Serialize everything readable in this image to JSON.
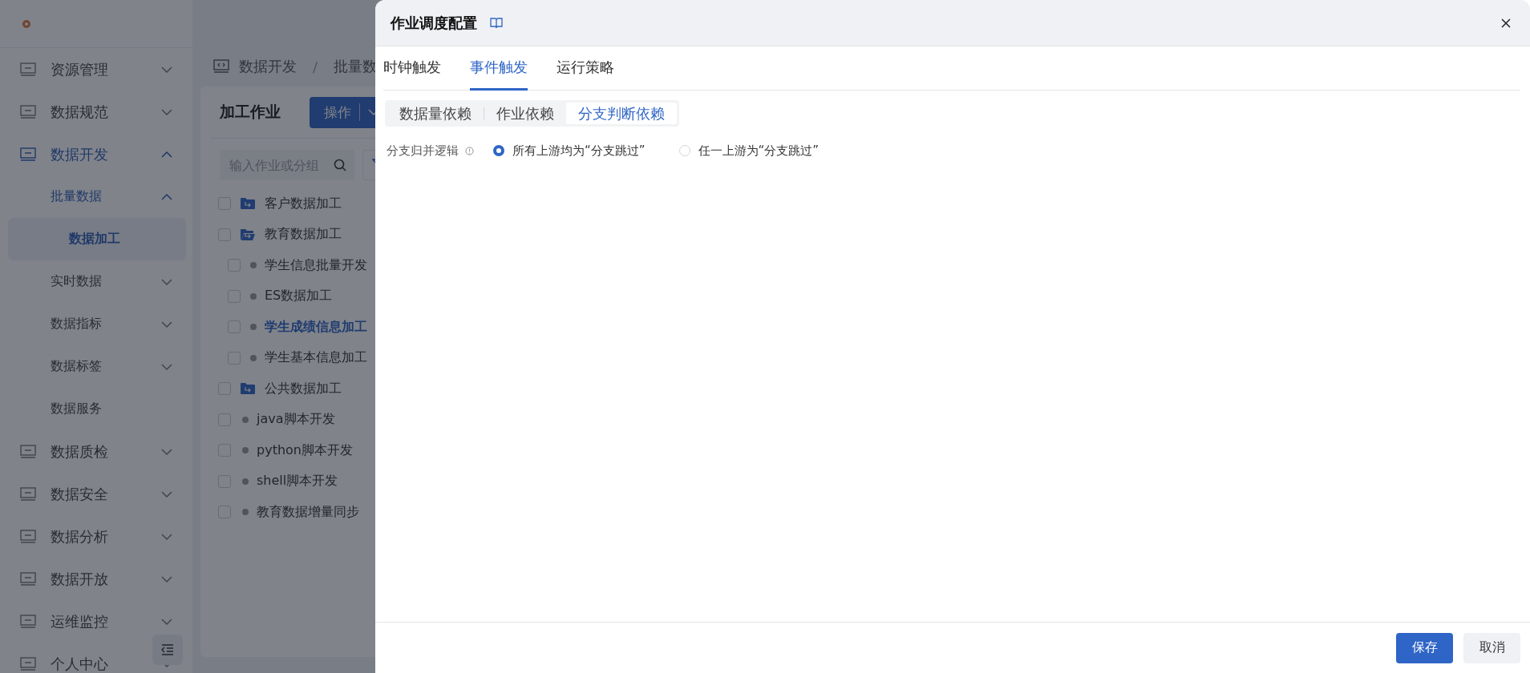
{
  "sidebar": {
    "items": [
      {
        "label": "资源管理",
        "expanded": false,
        "selected": false
      },
      {
        "label": "数据规范",
        "expanded": false,
        "selected": false
      },
      {
        "label": "数据开发",
        "expanded": true,
        "selected": false,
        "children": [
          {
            "label": "批量数据",
            "expanded": true,
            "selected": false,
            "children": [
              {
                "label": "数据加工",
                "selected": true
              }
            ]
          },
          {
            "label": "实时数据",
            "expanded": false,
            "selected": false
          },
          {
            "label": "数据指标",
            "expanded": false,
            "selected": false
          },
          {
            "label": "数据标签",
            "expanded": false,
            "selected": false
          },
          {
            "label": "数据服务",
            "selected": false
          }
        ]
      },
      {
        "label": "数据质检",
        "expanded": false,
        "selected": false
      },
      {
        "label": "数据安全",
        "expanded": false,
        "selected": false
      },
      {
        "label": "数据分析",
        "expanded": false,
        "selected": false
      },
      {
        "label": "数据开放",
        "expanded": false,
        "selected": false
      },
      {
        "label": "运维监控",
        "expanded": false,
        "selected": false
      },
      {
        "label": "个人中心",
        "expanded": false,
        "selected": false
      }
    ]
  },
  "breadcrumb": [
    "数据开发",
    "/",
    "批量数"
  ],
  "panel": {
    "title": "加工作业",
    "action_button": "操作",
    "search": {
      "placeholder": "输入作业或分组"
    }
  },
  "tree": [
    {
      "kind": "folder",
      "label": "客户数据加工",
      "expanded": false,
      "checked": false,
      "selected": false
    },
    {
      "kind": "folder",
      "label": "教育数据加工",
      "expanded": true,
      "checked": false,
      "selected": false,
      "children": [
        {
          "kind": "job",
          "label": "学生信息批量开发",
          "checked": false,
          "selected": false
        },
        {
          "kind": "job",
          "label": "ES数据加工",
          "checked": false,
          "selected": false
        },
        {
          "kind": "job",
          "label": "学生成绩信息加工",
          "checked": false,
          "selected": true
        },
        {
          "kind": "job",
          "label": "学生基本信息加工",
          "checked": false,
          "selected": false
        }
      ]
    },
    {
      "kind": "folder",
      "label": "公共数据加工",
      "expanded": false,
      "checked": false,
      "selected": false
    },
    {
      "kind": "job",
      "label": "java脚本开发",
      "checked": false,
      "selected": false
    },
    {
      "kind": "job",
      "label": "python脚本开发",
      "checked": false,
      "selected": false
    },
    {
      "kind": "job",
      "label": "shell脚本开发",
      "checked": false,
      "selected": false
    },
    {
      "kind": "job",
      "label": "教育数据增量同步",
      "checked": false,
      "selected": false
    }
  ],
  "drawer": {
    "title": "作业调度配置",
    "tabs": [
      {
        "label": "时钟触发",
        "selected": false
      },
      {
        "label": "事件触发",
        "selected": true
      },
      {
        "label": "运行策略",
        "selected": false
      }
    ],
    "subtabs": [
      {
        "label": "数据量依赖",
        "selected": false
      },
      {
        "label": "作业依赖",
        "selected": false
      },
      {
        "label": "分支判断依赖",
        "selected": true
      }
    ],
    "field": {
      "label": "分支归并逻辑",
      "options": [
        {
          "label": "所有上游均为“分支跳过”",
          "selected": true
        },
        {
          "label": "任一上游为“分支跳过”",
          "selected": false
        }
      ]
    },
    "buttons": [
      {
        "kind": "primary",
        "label": "保存"
      },
      {
        "kind": "default",
        "label": "取消"
      }
    ]
  }
}
